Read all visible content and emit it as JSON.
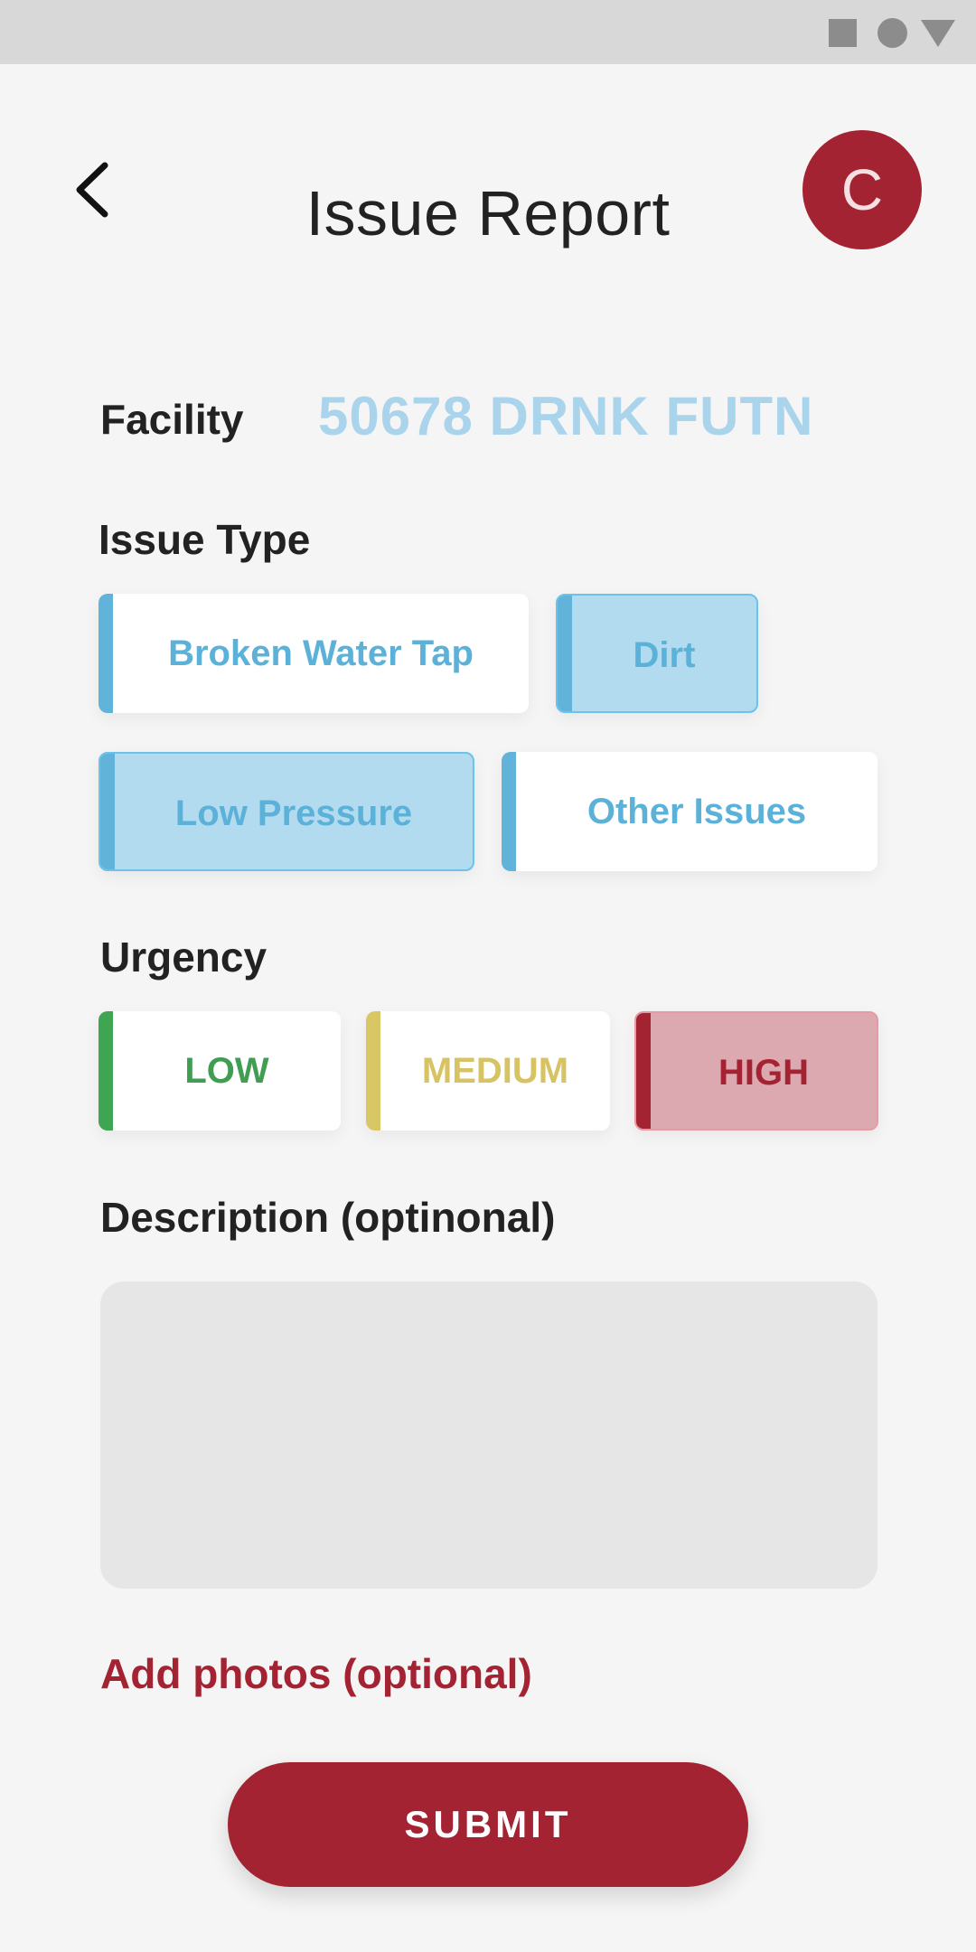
{
  "header": {
    "title": "Issue Report",
    "avatar_initial": "C",
    "back_icon": "chevron-left-icon"
  },
  "facility": {
    "label": "Facility",
    "value": "50678 DRNK FUTN"
  },
  "issue_type": {
    "label": "Issue Type",
    "options": [
      {
        "label": "Broken Water Tap",
        "selected": false
      },
      {
        "label": "Dirt",
        "selected": true
      },
      {
        "label": "Low Pressure",
        "selected": true
      },
      {
        "label": "Other Issues",
        "selected": false
      }
    ]
  },
  "urgency": {
    "label": "Urgency",
    "options": [
      {
        "label": "LOW",
        "color": "#3fa552",
        "selected": false
      },
      {
        "label": "MEDIUM",
        "color": "#d9c664",
        "selected": false
      },
      {
        "label": "HIGH",
        "color": "#a32333",
        "selected": true
      }
    ]
  },
  "description": {
    "label": "Description (optinonal)",
    "value": ""
  },
  "photos": {
    "label": "Add photos (optional)"
  },
  "submit": {
    "label": "SUBMIT"
  },
  "colors": {
    "accent": "#a32333",
    "chip_blue": "#62b3da",
    "chip_selected_bg": "#b3dbef"
  }
}
